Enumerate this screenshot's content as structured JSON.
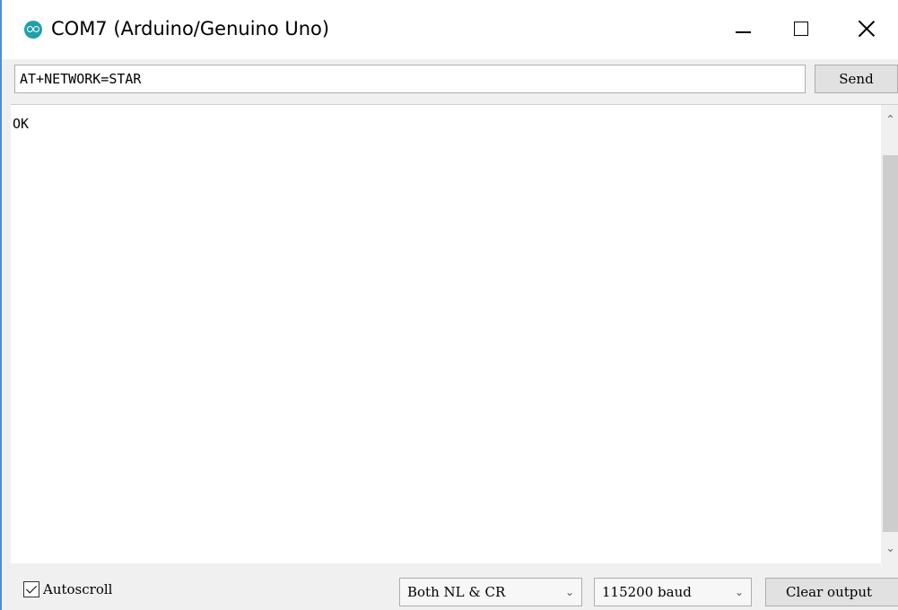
{
  "window": {
    "title": "COM7 (Arduino/Genuino Uno)"
  },
  "command": {
    "value": "AT+NETWORK=STAR",
    "send_label": "Send"
  },
  "output": {
    "lines": [
      "OK"
    ]
  },
  "footer": {
    "autoscroll_label": "Autoscroll",
    "autoscroll_checked": true,
    "line_ending": "Both NL & CR",
    "baud_rate": "115200 baud",
    "clear_label": "Clear output"
  },
  "icons": {
    "app": "arduino-logo-icon",
    "minimize": "minimize-icon",
    "maximize": "maximize-icon",
    "close": "close-icon",
    "dropdown": "chevron-down-icon"
  },
  "colors": {
    "accent": "#1ea0a8",
    "window_border": "#4a8fd8"
  }
}
